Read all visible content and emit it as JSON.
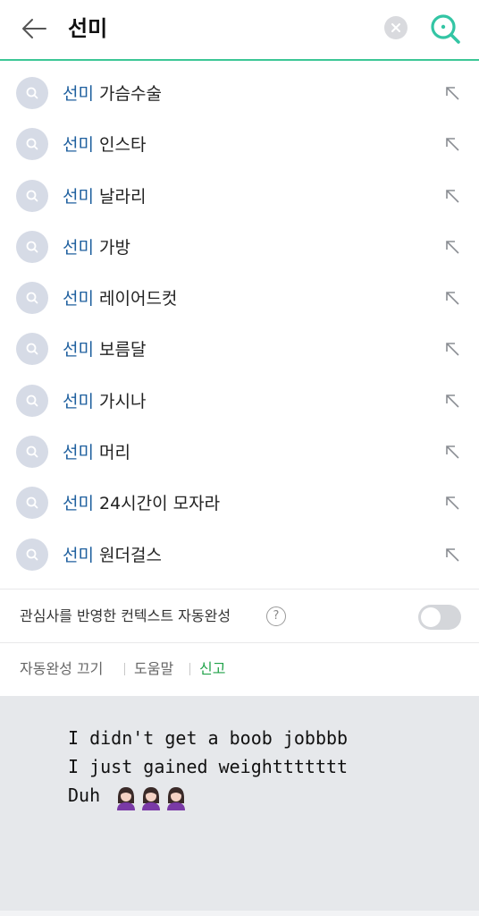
{
  "header": {
    "query": "선미",
    "back_icon": "arrow-left-icon",
    "clear_icon": "close-icon",
    "search_icon": "search-icon",
    "accent_color": "#3cc796"
  },
  "suggestions": [
    {
      "keyword": "선미",
      "rest": " 가슴수술"
    },
    {
      "keyword": "선미",
      "rest": " 인스타"
    },
    {
      "keyword": "선미",
      "rest": " 날라리"
    },
    {
      "keyword": "선미",
      "rest": " 가방"
    },
    {
      "keyword": "선미",
      "rest": " 레이어드컷"
    },
    {
      "keyword": "선미",
      "rest": " 보름달"
    },
    {
      "keyword": "선미",
      "rest": " 가시나"
    },
    {
      "keyword": "선미",
      "rest": " 머리"
    },
    {
      "keyword": "선미",
      "rest": " 24시간이 모자라"
    },
    {
      "keyword": "선미",
      "rest": " 원더걸스"
    }
  ],
  "context": {
    "label": "관심사를 반영한 컨텍스트 자동완성",
    "help": "?",
    "toggle_on": false
  },
  "footer": {
    "autocomplete_off": "자동완성 끄기",
    "help": "도움말",
    "report": "신고",
    "report_color": "#21a34a"
  },
  "note": {
    "line1": "I didn't get a boob jobbbb",
    "line2": "I just gained weighttttttt",
    "line3": "Duh",
    "emoji": "woman-raising-hand-emoji",
    "emoji_count": 3
  }
}
